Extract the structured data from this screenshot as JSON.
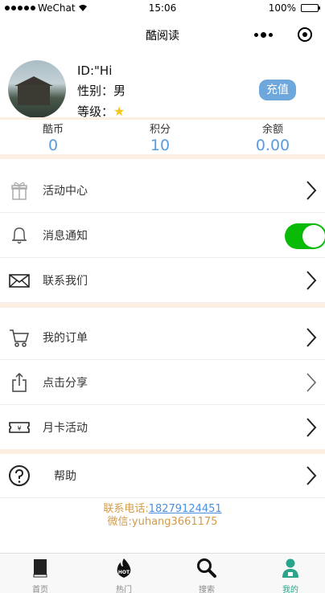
{
  "status": {
    "carrier": "WeChat",
    "time": "15:06",
    "battery": "100%"
  },
  "nav": {
    "title": "酷阅读"
  },
  "profile": {
    "id_line": "ID:\"Hi",
    "gender_label": "性别：男",
    "level_label": "等级：",
    "level_icon": "star-icon",
    "recharge": "充值"
  },
  "stats": [
    {
      "label": "酷币",
      "value": "0"
    },
    {
      "label": "积分",
      "value": "10"
    },
    {
      "label": "余额",
      "value": "0.00"
    }
  ],
  "menu": {
    "activity": "活动中心",
    "notify": "消息通知",
    "contact": "联系我们",
    "orders": "我的订单",
    "share": "点击分享",
    "monthly": "月卡活动",
    "help": "帮助"
  },
  "notify_on": true,
  "contact_info": {
    "phone_label": "联系电话:",
    "phone": "18279124451",
    "wechat": "微信:yuhang3661175"
  },
  "tabs": [
    {
      "label": "首页",
      "icon": "book-icon"
    },
    {
      "label": "热门",
      "icon": "hot-flame-icon"
    },
    {
      "label": "搜索",
      "icon": "search-icon"
    },
    {
      "label": "我的",
      "icon": "user-icon"
    }
  ],
  "colors": {
    "accent": "#5b9be0",
    "toggle": "#09bb07",
    "active_tab": "#2aa58b",
    "divider": "#fdeee2"
  }
}
